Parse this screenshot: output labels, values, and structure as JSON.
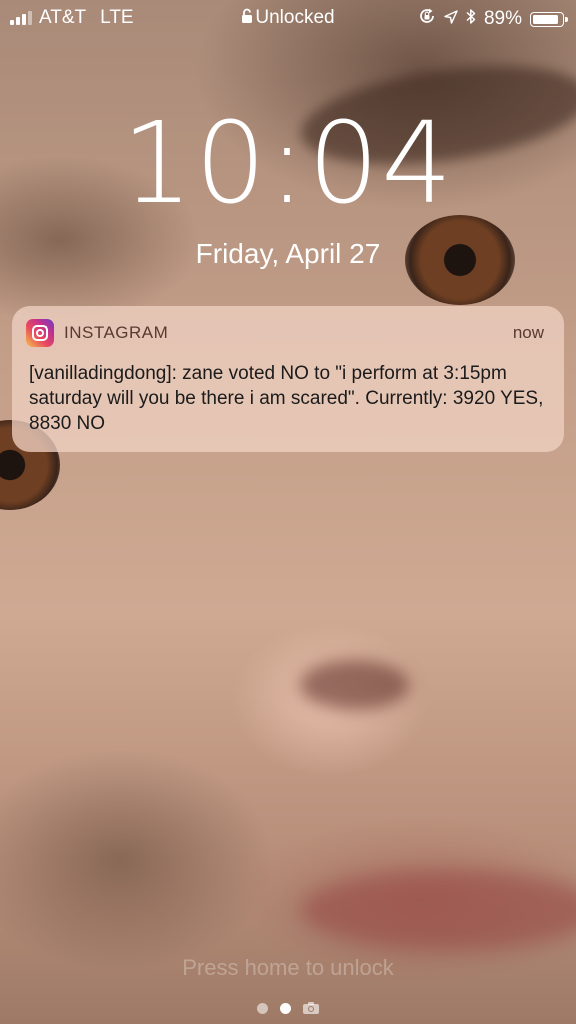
{
  "status_bar": {
    "carrier": "AT&T",
    "network": "LTE",
    "lock_status": "Unlocked",
    "battery_percent": "89%",
    "battery_level": 0.89,
    "signal_bars": 3,
    "signal_bars_total": 4,
    "icons": [
      "signal-icon",
      "lock-icon",
      "orientation-lock-icon",
      "location-icon",
      "bluetooth-icon",
      "battery-icon"
    ]
  },
  "lock_screen": {
    "time": "10:04",
    "date": "Friday, April 27",
    "hint": "Press home to unlock"
  },
  "notification": {
    "app_name": "INSTAGRAM",
    "time": "now",
    "icon": "instagram-icon",
    "body": "[vanilladingdong]: zane voted NO to \"i perform at 3:15pm saturday will you be there i am scared\". Currently: 3920 YES, 8830 NO"
  },
  "page_indicator": {
    "pages": 2,
    "active": 1,
    "extra_icon": "camera-icon"
  }
}
